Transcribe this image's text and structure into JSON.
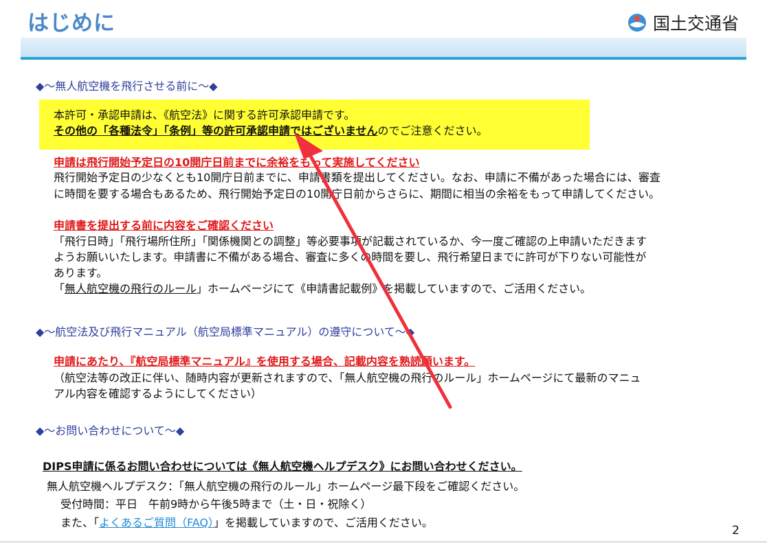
{
  "header": {
    "title": "はじめに",
    "ministry_name": "国土交通省"
  },
  "section1": {
    "heading": "◆～無人航空機を飛行させる前に～◆",
    "notice_line1": "本許可・承認申請は、《航空法》に関する許可承認申請です。",
    "notice_line2_underlined": "その他の「各種法令」「条例」等の許可承認申請ではございません",
    "notice_line2_rest": "のでご注意ください。",
    "block1_heading": "申請は飛行開始予定日の10開庁日前までに余裕をもって実施してください",
    "block1_line1": "飛行開始予定日の少なくとも10開庁日前までに、申請書類を提出してください。なお、申請に不備があった場合には、審査",
    "block1_line2": "に時間を要する場合もあるため、飛行開始予定日の10開庁日前からさらに、期間に相当の余裕をもって申請してください。",
    "block2_heading": "申請書を提出する前に内容をご確認ください",
    "block2_line1": "「飛行日時」「飛行場所住所」「関係機関との調整」等必要事項が記載されているか、今一度ご確認の上申請いただきます",
    "block2_line2": "ようお願いいたします。申請書に不備がある場合、審査に多くの時間を要し、飛行希望日までに許可が下りない可能性が",
    "block2_line3": "あります。",
    "block2_line4_open": "「",
    "block2_line4_link": "無人航空機の飛行のルール",
    "block2_line4_rest": "」ホームページにて《申請書記載例》を掲載していますので、ご活用ください。"
  },
  "section2": {
    "heading": "◆～航空法及び飛行マニュアル（航空局標準マニュアル）の遵守について～◆",
    "red_heading": "申請にあたり、『航空局標準マニュアル』を使用する場合、記載内容を熟読願います。",
    "line1": "（航空法等の改正に伴い、随時内容が更新されますので、「無人航空機の飛行のルール」ホームページにて最新のマニュ",
    "line2": "アル内容を確認するようにしてください）"
  },
  "section3": {
    "heading": "◆～お問い合わせについて～◆",
    "bold_line": "DIPS申請に係るお問い合わせについては《無人航空機ヘルプデスク》にお問い合わせください。",
    "helpdesk_line": "無人航空機ヘルプデスク：「無人航空機の飛行のルール」ホームページ最下段をご確認ください。",
    "hours_line": "受付時間：平日　午前9時から午後5時まで（土・日・祝除く）",
    "faq_prefix": "また、「",
    "faq_link": "よくあるご質問（FAQ）",
    "faq_suffix": "」を掲載していますので、ご活用ください。"
  },
  "footer": {
    "page_number": "2"
  },
  "colors": {
    "title": "#4a89c8",
    "heading": "#2f3f9a",
    "emphasis": "#e01818",
    "highlight": "#ffff33",
    "accent_line": "#2aa3d6",
    "arrow": "#f0303a"
  },
  "icons": {
    "logo": "mlit-logo-icon",
    "annotation": "red-arrow-icon"
  }
}
